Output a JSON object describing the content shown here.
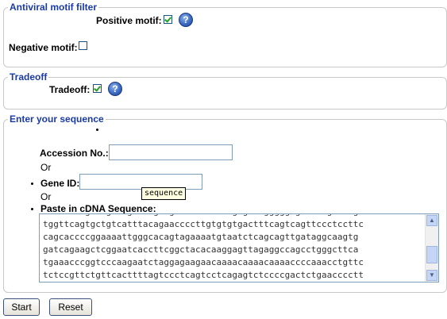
{
  "antiviral": {
    "legend": "Antiviral motif filter",
    "positive_label": "Positive motif:",
    "positive_checked": true,
    "negative_label": "Negative motif:",
    "negative_checked": false
  },
  "tradeoff": {
    "legend": "Tradeoff",
    "label": "Tradeoff:",
    "checked": true
  },
  "sequence": {
    "legend": "Enter your sequence",
    "accession_label": "Accession No.:",
    "accession_value": "",
    "or1": "Or",
    "gene_label": "Gene ID:",
    "gene_value": "",
    "or2": "Or",
    "cdna_label": "Paste in cDNA Sequence:",
    "tooltip": "sequence",
    "lines": [
      "tggttcagtgctgtcatttacagaaccccttgtgtgtgactttcagtcagttccctccttc",
      "cagcaccccggaaaattgggcacagtagaaaatgtaatctcagcagttgataggcaagtg",
      "gatcagaagctcggaatcaccttcggctacacaaggagttagaggccagcctgggcttca",
      "tgaaacccggtcccaagaatctaggagaagaacaaaacaaaacaaaaccccaaacctgttc",
      "tctccgttctgttcacttttagtccctcagtcctcagagtctccccgactctgaacccctt"
    ]
  },
  "buttons": {
    "start": "Start",
    "reset": "Reset"
  },
  "icons": {
    "help": "help-icon",
    "scroll_up": "scroll-up-arrow-icon",
    "scroll_down": "scroll-down-arrow-icon"
  }
}
